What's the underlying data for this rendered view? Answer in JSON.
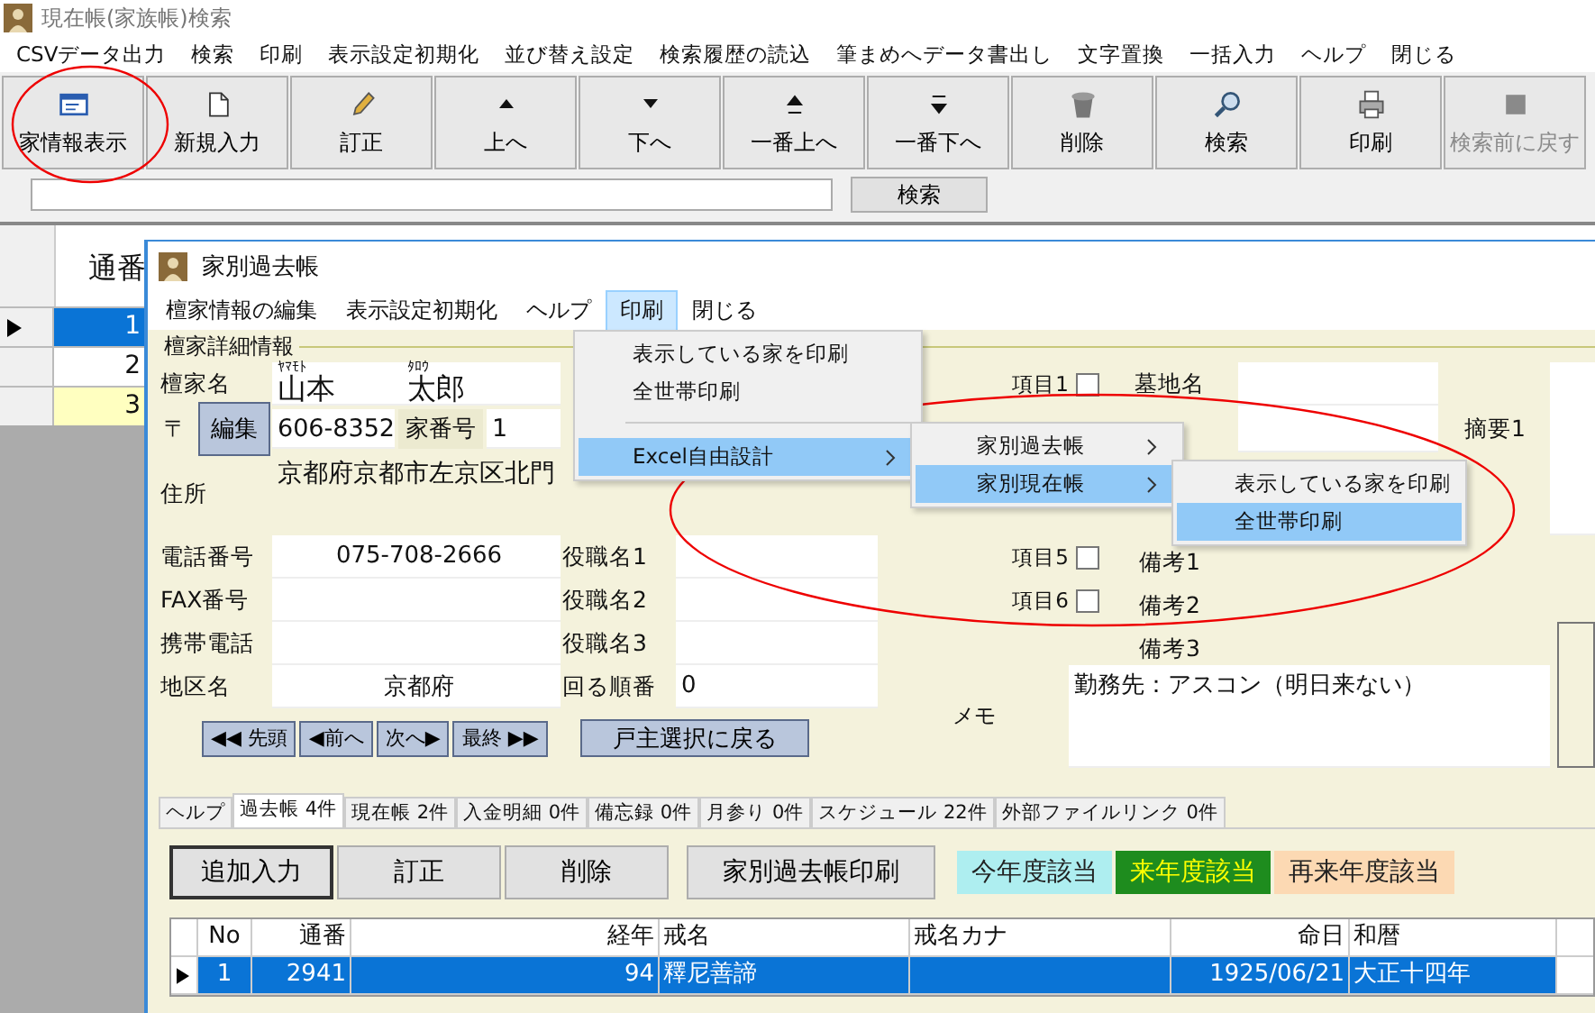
{
  "window": {
    "title": "現在帳(家族帳)検索"
  },
  "menu": [
    "CSVデータ出力",
    "検索",
    "印刷",
    "表示設定初期化",
    "並び替え設定",
    "検索履歴の読込",
    "筆まめへデータ書出し",
    "文字置換",
    "一括入力",
    "ヘルプ",
    "閉じる"
  ],
  "toolbar": [
    {
      "label": "家情報表示",
      "disabled": false
    },
    {
      "label": "新規入力",
      "disabled": false
    },
    {
      "label": "訂正",
      "disabled": false
    },
    {
      "label": "上へ",
      "disabled": false
    },
    {
      "label": "下へ",
      "disabled": false
    },
    {
      "label": "一番上へ",
      "disabled": false
    },
    {
      "label": "一番下へ",
      "disabled": false
    },
    {
      "label": "削除",
      "disabled": false
    },
    {
      "label": "検索",
      "disabled": false
    },
    {
      "label": "印刷",
      "disabled": false
    },
    {
      "label": "検索前に戻す",
      "disabled": true
    }
  ],
  "search": {
    "button": "検索"
  },
  "grid": {
    "columns": [
      "通番"
    ],
    "rows": [
      {
        "cells": [
          "1"
        ],
        "selected": true,
        "highlighted": false
      },
      {
        "cells": [
          "2"
        ],
        "selected": false,
        "highlighted": false
      },
      {
        "cells": [
          "3"
        ],
        "selected": false,
        "highlighted": true
      }
    ]
  },
  "dialog": {
    "title": "家別過去帳",
    "menu": [
      {
        "label": "檀家情報の編集",
        "open": false
      },
      {
        "label": "表示設定初期化",
        "open": false
      },
      {
        "label": "ヘルプ",
        "open": false
      },
      {
        "label": "印刷",
        "open": true
      },
      {
        "label": "閉じる",
        "open": false
      }
    ],
    "section_title": "檀家詳細情報",
    "name_label": "檀家名",
    "surname_kana": "ﾔﾏﾓﾄ",
    "surname": "山本",
    "given_kana": "ﾀﾛｳ",
    "given_name": "太郎",
    "postal_label": "〒",
    "edit_button": "編集",
    "postal_code": "606-8352",
    "house_no_label": "家番号",
    "house_no": "1",
    "address_label": "住所",
    "address": "京都府京都市左京区北門",
    "phone_label": "電話番号",
    "phone": "075-708-2666",
    "fax_label": "FAX番号",
    "mobile_label": "携帯電話",
    "district_label": "地区名",
    "district": "京都府",
    "roles": [
      {
        "label": "役職名1"
      },
      {
        "label": "役職名2"
      },
      {
        "label": "役職名3"
      }
    ],
    "order_label": "回る順番",
    "order": "0",
    "checks": [
      {
        "label": "項目1",
        "checked": false
      },
      {
        "label": "項目5",
        "checked": false
      },
      {
        "label": "項目6",
        "checked": false
      }
    ],
    "grave_label": "墓地名",
    "summary_label": "摘要1",
    "notes": [
      {
        "label": "備考1"
      },
      {
        "label": "備考2"
      },
      {
        "label": "備考3"
      }
    ],
    "memo_label": "メモ",
    "memo": "勤務先：アスコン（明日来ない）",
    "nav": [
      "◀◀ 先頭",
      "◀前へ",
      "次へ▶",
      "最終 ▶▶"
    ],
    "back_button": "戸主選択に戻る",
    "tabs": [
      {
        "label": "ヘルプ",
        "selected": false
      },
      {
        "label": "過去帳 4件",
        "selected": true
      },
      {
        "label": "現在帳 2件",
        "selected": false
      },
      {
        "label": "入金明細 0件",
        "selected": false
      },
      {
        "label": "備忘録 0件",
        "selected": false
      },
      {
        "label": "月参り 0件",
        "selected": false
      },
      {
        "label": "スケジュール 22件",
        "selected": false
      },
      {
        "label": "外部ファイルリンク 0件",
        "selected": false
      }
    ],
    "buttons": [
      {
        "label": "追加入力",
        "focused": true
      },
      {
        "label": "訂正",
        "focused": false
      },
      {
        "label": "削除",
        "focused": false
      }
    ],
    "print_button": "家別過去帳印刷",
    "legend": [
      {
        "label": "今年度該当",
        "color": "#aeeef0"
      },
      {
        "label": "来年度該当",
        "color": "#1e8c1e"
      },
      {
        "label": "再来年度該当",
        "color": "#fcd9b3"
      }
    ],
    "table": {
      "columns": [
        "No",
        "通番",
        "経年",
        "戒名",
        "戒名カナ",
        "命日",
        "和暦"
      ],
      "rows": [
        {
          "cells": [
            "1",
            "2941",
            "94",
            "釋尼善諦",
            "",
            "1925/06/21",
            "大正十四年"
          ],
          "selected": true
        }
      ]
    },
    "print_menu": [
      {
        "kind": "item",
        "label": "表示している家を印刷",
        "highlighted": false
      },
      {
        "kind": "item",
        "label": "全世帯印刷",
        "highlighted": false
      },
      {
        "kind": "separator"
      },
      {
        "kind": "submenu",
        "label": "Excel自由設計",
        "highlighted": true
      }
    ],
    "excel_menu": [
      {
        "label": "家別過去帳",
        "highlighted": false,
        "submenu": true
      },
      {
        "label": "家別現在帳",
        "highlighted": true,
        "submenu": true
      }
    ],
    "current_menu": [
      {
        "label": "表示している家を印刷",
        "highlighted": false
      },
      {
        "label": "全世帯印刷",
        "highlighted": true
      }
    ]
  }
}
